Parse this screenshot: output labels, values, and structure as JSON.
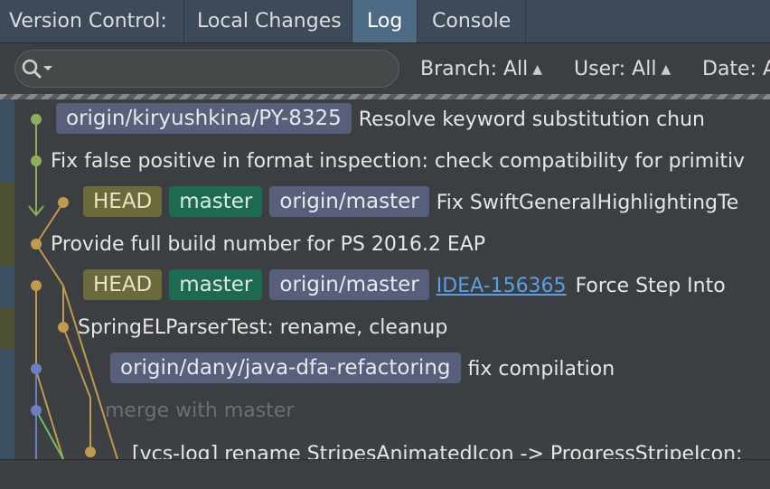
{
  "tabs": {
    "title": "Version Control:",
    "items": [
      {
        "label": "Local Changes"
      },
      {
        "label": "Log"
      },
      {
        "label": "Console"
      }
    ]
  },
  "toolbar": {
    "branch": "Branch: All",
    "user": "User: All",
    "date": "Date: A"
  },
  "log": {
    "rows": [
      {
        "labels": [
          "origin/kiryushkina/PY-8325"
        ],
        "message": "Resolve keyword substitution chun"
      },
      {
        "message": "Fix false positive in format inspection: check compatibility for primitiv"
      },
      {
        "labels": [
          "HEAD",
          "master",
          "origin/master"
        ],
        "message": "Fix SwiftGeneralHighlightingTe"
      },
      {
        "message": "Provide full build number for PS 2016.2 EAP"
      },
      {
        "labels": [
          "HEAD",
          "master",
          "origin/master"
        ],
        "issue": "IDEA-156365",
        "message": "Force Step Into"
      },
      {
        "message": "SpringELParserTest: rename, cleanup"
      },
      {
        "labels": [
          "origin/dany/java-dfa-refactoring"
        ],
        "message": "fix compilation"
      },
      {
        "message": "merge with master"
      },
      {
        "message": "[vcs-log] rename StripesAnimatedIcon -> ProgressStripeIcon;"
      }
    ]
  },
  "colors": {
    "graph_green": "#8fae5a",
    "graph_orange": "#c19a4e",
    "graph_blue": "#6d7fc3",
    "graph_lightgreen": "#6fbf5d"
  }
}
